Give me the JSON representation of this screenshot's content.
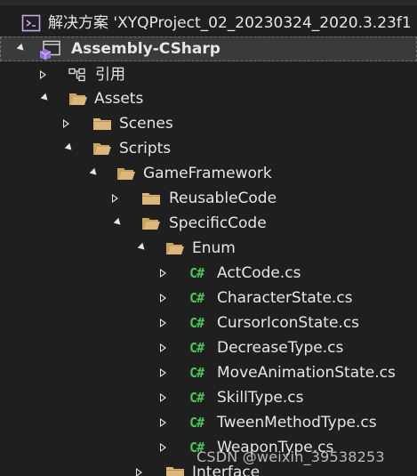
{
  "solution_explorer": {
    "solution_label": "解决方案 'XYQProject_02_20230324_2020.3.23f1",
    "project_label": "Assembly-CSharp",
    "references_label": "引用",
    "folders": {
      "assets": "Assets",
      "scenes": "Scenes",
      "scripts": "Scripts",
      "gameframework": "GameFramework",
      "reusablecode": "ReusableCode",
      "specificcode": "SpecificCode",
      "enum": "Enum",
      "interface": "Interface"
    },
    "files": [
      "ActCode.cs",
      "CharacterState.cs",
      "CursorIconState.cs",
      "DecreaseType.cs",
      "MoveAnimationState.cs",
      "SkillType.cs",
      "TweenMethodType.cs",
      "WeaponType.cs"
    ],
    "cs_badge": "C#"
  },
  "watermark": "CSDN @weixin_39538253",
  "colors": {
    "background": "#1f1f1f",
    "folder": "#dcb67a",
    "csharp": "#4cc25a",
    "text": "#e6e6e6"
  }
}
